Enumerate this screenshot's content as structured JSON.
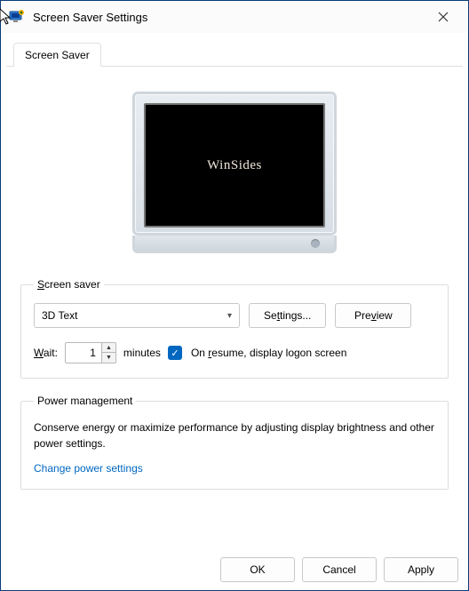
{
  "window": {
    "title": "Screen Saver Settings"
  },
  "tab": {
    "label": "Screen Saver"
  },
  "preview_monitor": {
    "text": "WinSides"
  },
  "screensaver_group": {
    "legend": "Screen saver",
    "selected": "3D Text",
    "settings_btn": "Settings...",
    "preview_btn": "Preview",
    "wait_label": "Wait:",
    "wait_value": "1",
    "minutes_label": "minutes",
    "resume_label": "On resume, display logon screen",
    "resume_checked": true
  },
  "power_group": {
    "legend": "Power management",
    "desc": "Conserve energy or maximize performance by adjusting display brightness and other power settings.",
    "link": "Change power settings"
  },
  "footer": {
    "ok": "OK",
    "cancel": "Cancel",
    "apply": "Apply"
  }
}
